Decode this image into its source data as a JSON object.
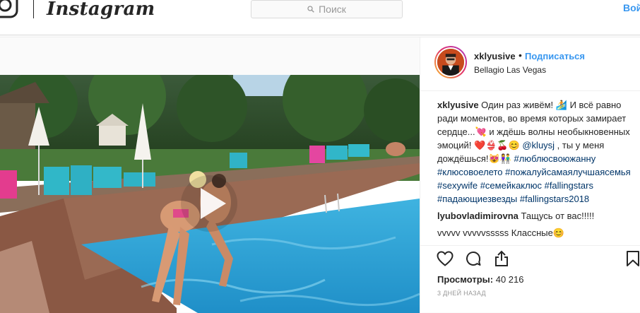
{
  "header": {
    "brand": "Instagram",
    "search_placeholder": "Поиск",
    "login_label": "Вой"
  },
  "post": {
    "username": "xklyusive",
    "separator": "•",
    "follow_label": "Подписаться",
    "location": "Bellagio Las Vegas",
    "caption": {
      "user": "xklyusive",
      "text1": " Один раз живём! 🏄 И всё равно ради моментов, во время которых замирает сердце...💘 и ждёшь волны необыкновенных эмоций! ❤️👙🍒😊 ",
      "mention": "@kluysj",
      "text2": " , ты у меня дождёшься!😻👫",
      "hashtags": [
        "#люблюсвоюжанну",
        "#клюсовоелето",
        "#пожалуйсамаялучшаясемья",
        "#sexywife",
        "#семейкаклюс",
        "#fallingstars",
        "#падающиезвезды",
        "#fallingstars2018"
      ]
    },
    "comments": [
      {
        "user": "lyubovladimirovna",
        "text": " Тащусь от вас!!!!!"
      },
      {
        "user": "",
        "text": "vvvvv vvvvvsssss Классные😊"
      }
    ],
    "views_label": "Просмотры:",
    "views_count": "40 216",
    "date": "3 ДНЕЙ НАЗАД"
  },
  "icons": {
    "like": "heart-icon",
    "comment": "comment-bubble-icon",
    "share": "share-icon",
    "save": "bookmark-icon",
    "play": "play-icon",
    "search": "search-icon"
  },
  "colors": {
    "link": "#3897f0",
    "hashtag": "#003569",
    "text": "#262626",
    "muted": "#999999",
    "border": "#dbdbdb"
  }
}
